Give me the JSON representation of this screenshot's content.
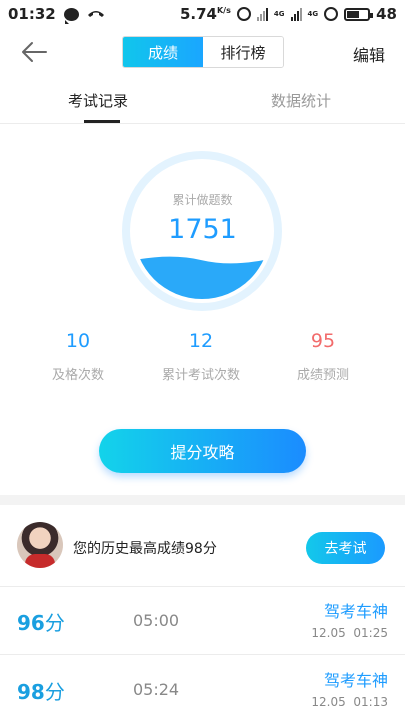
{
  "status_bar": {
    "time": "01:32",
    "speed": "5.74",
    "speed_unit": "K/s",
    "signal_label_1": "4G",
    "signal_label_2": "4G",
    "battery": "48"
  },
  "header": {
    "segments": [
      "成绩",
      "排行榜"
    ],
    "active_segment": "成绩",
    "edit_label": "编辑"
  },
  "tabs": [
    "考试记录",
    "数据统计"
  ],
  "gauge": {
    "title": "累计做题数",
    "value": "1751",
    "fill_fraction": 0.3,
    "color": "#2aa9f9"
  },
  "stats": [
    {
      "value": "10",
      "label": "及格次数"
    },
    {
      "value": "12",
      "label": "累计考试次数"
    },
    {
      "value": "95",
      "label": "成绩预测"
    }
  ],
  "strategy_button": "提分攻略",
  "best_score": {
    "text": "您的历史最高成绩98分",
    "button": "去考试"
  },
  "records": [
    {
      "score": "96",
      "unit": "分",
      "duration": "05:00",
      "rank": "驾考车神",
      "date": "12.05",
      "time": "01:25"
    },
    {
      "score": "98",
      "unit": "分",
      "duration": "05:24",
      "rank": "驾考车神",
      "date": "12.05",
      "time": "01:13"
    }
  ],
  "colors": {
    "accent": "#1e9cff",
    "accent_cyan": "#13d3ea",
    "warning": "#f26b6b"
  }
}
